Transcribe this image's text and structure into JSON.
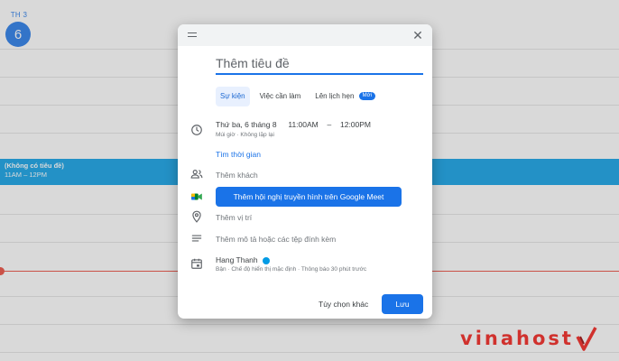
{
  "day_header": {
    "weekday": "TH 3",
    "date": "6"
  },
  "calendar_event": {
    "title": "(Không có tiêu đề)",
    "time": "11AM – 12PM"
  },
  "dialog": {
    "title_placeholder": "Thêm tiêu đề",
    "tabs": [
      {
        "label": "Sự kiện",
        "active": true
      },
      {
        "label": "Việc cần làm",
        "active": false
      },
      {
        "label": "Lên lịch hẹn",
        "active": false,
        "badge": "Mới"
      }
    ],
    "datetime": {
      "date": "Thứ ba, 6 tháng 8",
      "start": "11:00AM",
      "separator": "–",
      "end": "12:00PM",
      "subline": "Múi giờ · Không lặp lại"
    },
    "find_time_link": "Tìm thời gian",
    "add_guests": "Thêm khách",
    "meet_button": "Thêm hội nghị truyền hình trên Google Meet",
    "add_location": "Thêm vị trí",
    "add_description": "Thêm mô tả hoặc các tệp đính kèm",
    "calendar_owner": {
      "name": "Hang Thanh",
      "details": "Bận · Chế độ hiển thị mặc định · Thông báo 30 phút trước"
    },
    "more_options_button": "Tùy chọn khác",
    "save_button": "Lưu"
  },
  "watermark": {
    "text": "vinahost"
  },
  "colors": {
    "primary": "#1a73e8",
    "event": "#039be5",
    "current_time": "#ea4335",
    "watermark": "#d0312d"
  },
  "icons": [
    "menu-handle-icon",
    "close-icon",
    "clock-icon",
    "guests-icon",
    "google-meet-icon",
    "location-pin-icon",
    "description-icon",
    "calendar-icon"
  ]
}
